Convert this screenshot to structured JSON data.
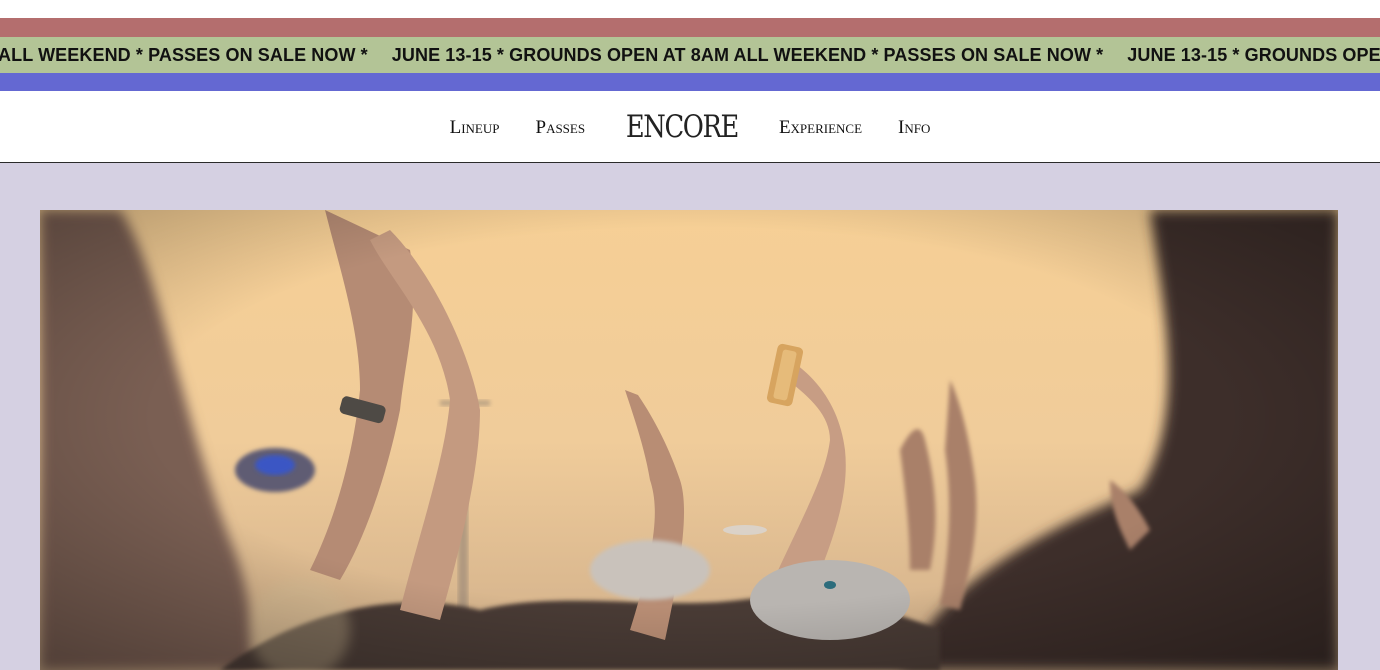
{
  "ticker": {
    "segments": [
      "ALL WEEKEND * PASSES ON SALE NOW *",
      "JUNE 13-15 * GROUNDS OPEN AT 8AM ALL WEEKEND * PASSES ON SALE NOW *",
      "JUNE 13-15 * GROUNDS OPEN"
    ]
  },
  "nav": {
    "lineup": "Lineup",
    "passes": "Passes",
    "logo": "ENCORE",
    "experience": "Experience",
    "info": "Info"
  },
  "colors": {
    "stripe_red": "#b46e6e",
    "stripe_green": "#b3c496",
    "stripe_blue": "#6468d2",
    "page_background": "#d5d0e2"
  },
  "hero": {
    "image": "concert-crowd-hands-raised-photo"
  }
}
